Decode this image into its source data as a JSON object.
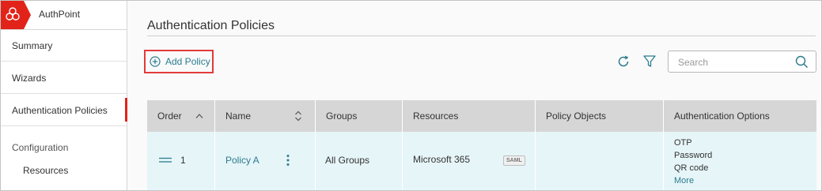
{
  "colors": {
    "brand_red": "#e2231a",
    "link_teal": "#2b7c8f",
    "row_highlight": "#e6f5f8",
    "header_gray": "#d6d6d6",
    "highlight_box": "#e23a3a"
  },
  "brand": {
    "logo_icon": "watchguard-logo-icon",
    "name": "AuthPoint"
  },
  "sidebar": {
    "items": [
      {
        "label": "Summary"
      },
      {
        "label": "Wizards"
      },
      {
        "label": "Authentication Policies",
        "active": true
      }
    ],
    "section": "Configuration",
    "sub_items": [
      {
        "label": "Resources"
      }
    ]
  },
  "main": {
    "title": "Authentication Policies",
    "add_button": {
      "label": "Add Policy",
      "icon": "plus-circle-icon"
    },
    "toolbar": {
      "refresh_icon": "refresh-icon",
      "filter_icon": "filter-icon"
    },
    "search": {
      "placeholder": "Search",
      "value": "",
      "icon": "search-icon"
    }
  },
  "table": {
    "columns": [
      {
        "label": "Order",
        "sort_icon": "chevron-up-icon"
      },
      {
        "label": "Name",
        "sort_icon": "sort-updown-icon"
      },
      {
        "label": "Groups"
      },
      {
        "label": "Resources"
      },
      {
        "label": "Policy Objects"
      },
      {
        "label": "Authentication Options"
      }
    ],
    "rows": [
      {
        "drag_icon": "drag-handle-icon",
        "order": "1",
        "name": "Policy A",
        "menu_icon": "more-vertical-icon",
        "groups": "All Groups",
        "resources": "Microsoft 365",
        "resource_badge": "SAML",
        "policy_objects": "",
        "auth_options": [
          "OTP",
          "Password",
          "QR code"
        ],
        "more_label": "More"
      }
    ]
  }
}
